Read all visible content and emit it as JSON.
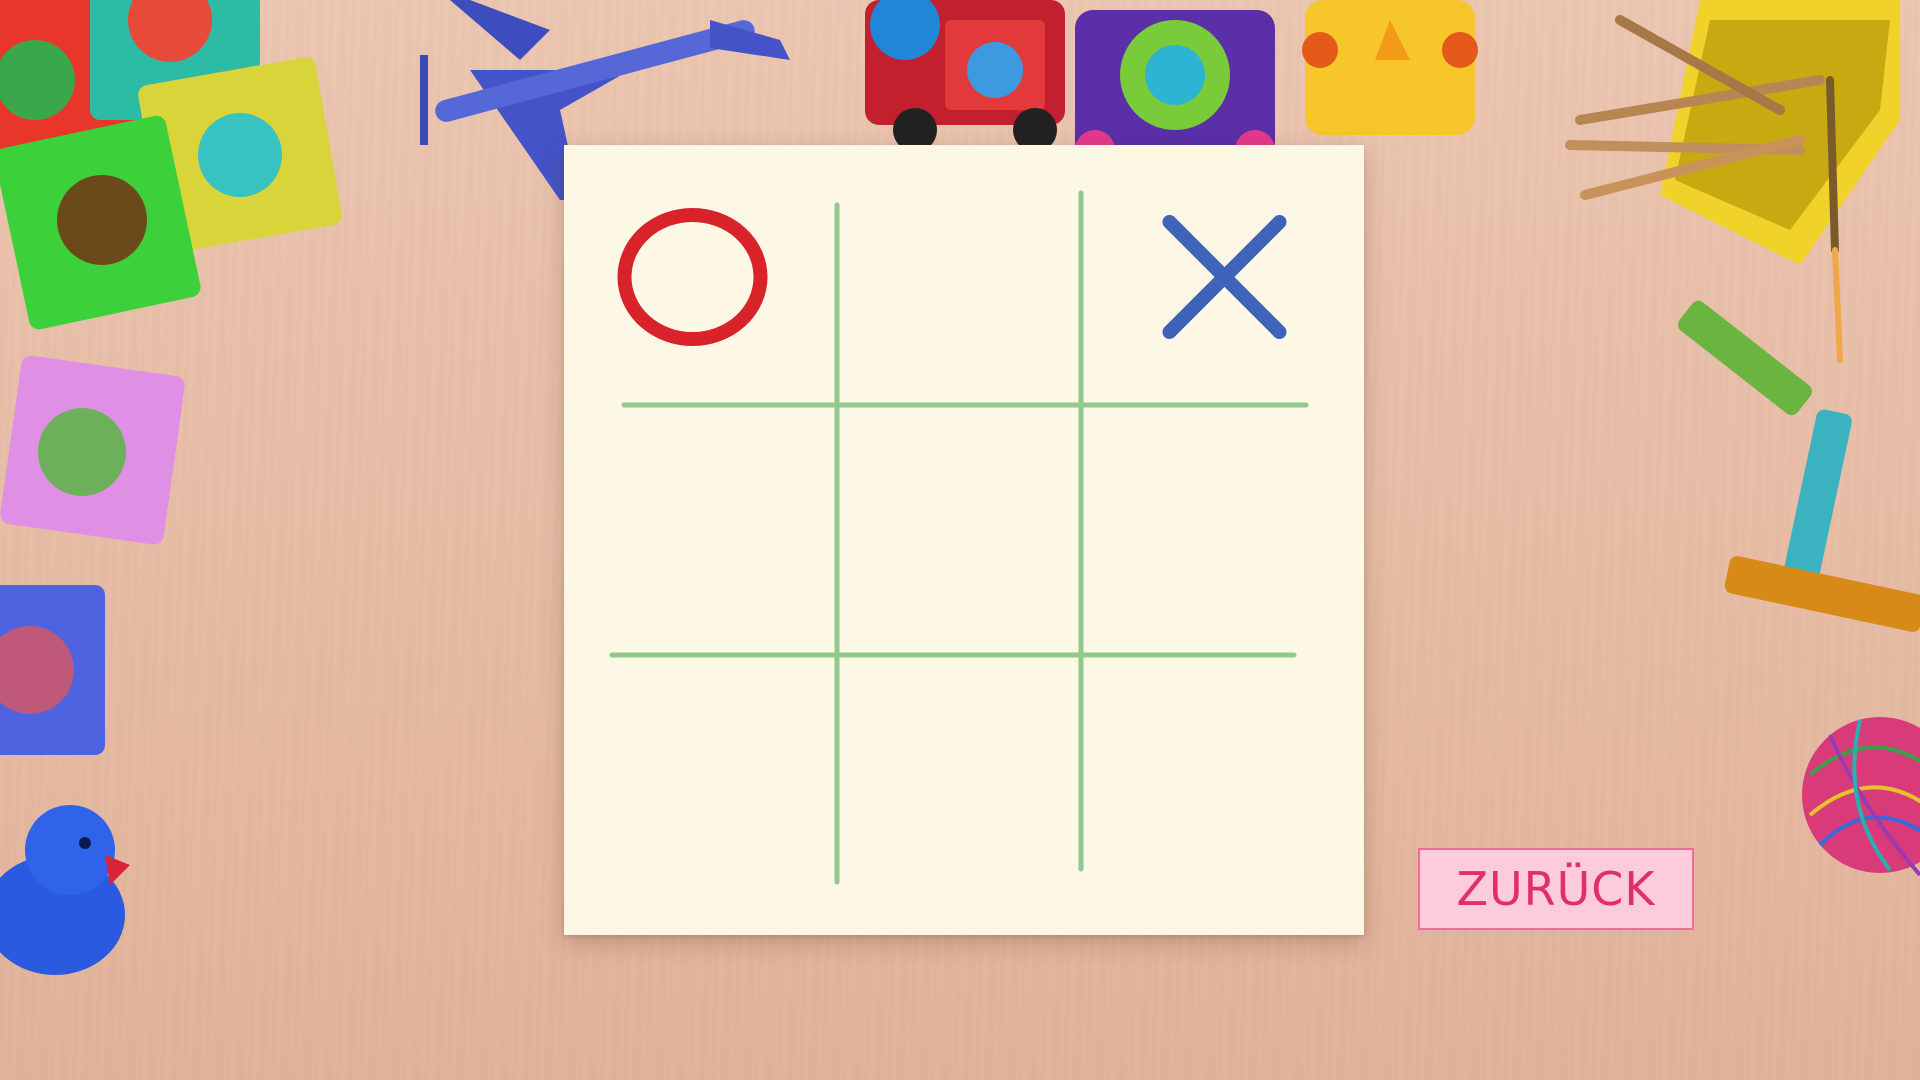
{
  "game": {
    "board": [
      "O",
      "",
      "X",
      "",
      "",
      "",
      "",
      "",
      ""
    ],
    "colors": {
      "grid_line": "#8fc98d",
      "o_mark": "#d8232a",
      "x_mark": "#3f63b8",
      "paper": "#fdf8e6"
    }
  },
  "controls": {
    "back_label": "ZURÜCK",
    "back_color": "#e0306a",
    "back_background": "#fccbdc"
  },
  "decorations": [
    "foam-puzzle-tiles",
    "toy-airplane",
    "toy-train",
    "pencil-cup",
    "wax-crayons",
    "yarn-ball",
    "rubber-duck"
  ]
}
